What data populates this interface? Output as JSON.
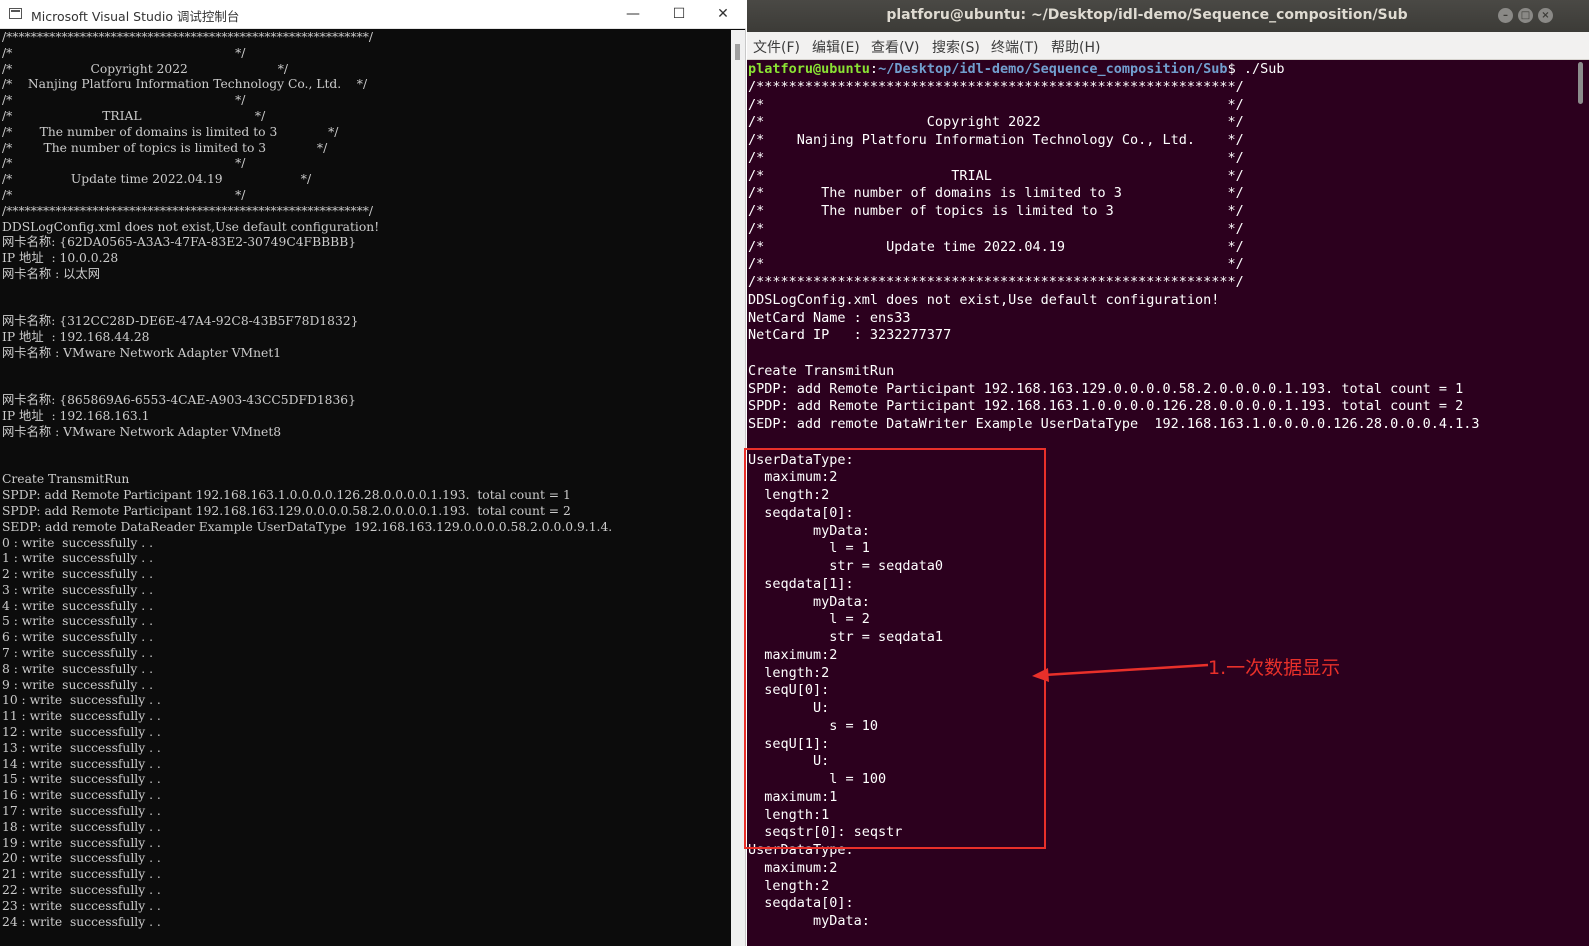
{
  "left_window": {
    "title": "Microsoft Visual Studio 调试控制台",
    "controls": {
      "minimize": "—",
      "maximize": "☐",
      "close": "✕"
    },
    "lines": [
      "/***********************************************************/",
      "/*                                                         */",
      "/*                    Copyright 2022                       */",
      "/*    Nanjing Platforu Information Technology Co., Ltd.    */",
      "/*                                                         */",
      "/*                       TRIAL                             */",
      "/*       The number of domains is limited to 3             */",
      "/*        The number of topics is limited to 3             */",
      "/*                                                         */",
      "/*               Update time 2022.04.19                    */",
      "/*                                                         */",
      "/***********************************************************/",
      "DDSLogConfig.xml does not exist,Use default configuration!",
      "网卡名称: {62DA0565-A3A3-47FA-83E2-30749C4FBBBB}",
      "IP 地址  : 10.0.0.28",
      "网卡名称 : 以太网",
      "",
      "",
      "网卡名称: {312CC28D-DE6E-47A4-92C8-43B5F78D1832}",
      "IP 地址  : 192.168.44.28",
      "网卡名称 : VMware Network Adapter VMnet1",
      "",
      "",
      "网卡名称: {865869A6-6553-4CAE-A903-43CC5DFD1836}",
      "IP 地址  : 192.168.163.1",
      "网卡名称 : VMware Network Adapter VMnet8",
      "",
      "",
      "Create TransmitRun",
      "SPDP: add Remote Participant 192.168.163.1.0.0.0.0.126.28.0.0.0.0.1.193.  total count = 1",
      "SPDP: add Remote Participant 192.168.163.129.0.0.0.0.58.2.0.0.0.0.1.193.  total count = 2",
      "SEDP: add remote DataReader Example UserDataType  192.168.163.129.0.0.0.0.58.2.0.0.0.9.1.4.",
      "0 : write  successfully . .",
      "1 : write  successfully . .",
      "2 : write  successfully . .",
      "3 : write  successfully . .",
      "4 : write  successfully . .",
      "5 : write  successfully . .",
      "6 : write  successfully . .",
      "7 : write  successfully . .",
      "8 : write  successfully . .",
      "9 : write  successfully . .",
      "10 : write  successfully . .",
      "11 : write  successfully . .",
      "12 : write  successfully . .",
      "13 : write  successfully . .",
      "14 : write  successfully . .",
      "15 : write  successfully . .",
      "16 : write  successfully . .",
      "17 : write  successfully . .",
      "18 : write  successfully . .",
      "19 : write  successfully . .",
      "20 : write  successfully . .",
      "21 : write  successfully . .",
      "22 : write  successfully . .",
      "23 : write  successfully . .",
      "24 : write  successfully . ."
    ]
  },
  "right_window": {
    "title": "platforu@ubuntu: ~/Desktop/idl-demo/Sequence_composition/Sub",
    "controls": {
      "minimize": "–",
      "maximize": "□",
      "close": "×"
    },
    "menu": [
      "文件(F)",
      "编辑(E)",
      "查看(V)",
      "搜索(S)",
      "终端(T)",
      "帮助(H)"
    ],
    "prompt": {
      "user_host": "platforu@ubuntu",
      "separator": ":",
      "path": "~/Desktop/idl-demo/Sequence_composition/Sub",
      "symbol": "$ ",
      "command": "./Sub"
    },
    "lines": [
      "/***********************************************************/",
      "/*                                                         */",
      "/*                    Copyright 2022                       */",
      "/*    Nanjing Platforu Information Technology Co., Ltd.    */",
      "/*                                                         */",
      "/*                       TRIAL                             */",
      "/*       The number of domains is limited to 3             */",
      "/*       The number of topics is limited to 3              */",
      "/*                                                         */",
      "/*               Update time 2022.04.19                    */",
      "/*                                                         */",
      "/***********************************************************/",
      "DDSLogConfig.xml does not exist,Use default configuration!",
      "NetCard Name : ens33",
      "NetCard IP   : 3232277377",
      "",
      "Create TransmitRun",
      "SPDP: add Remote Participant 192.168.163.129.0.0.0.0.58.2.0.0.0.0.1.193. total count = 1",
      "SPDP: add Remote Participant 192.168.163.1.0.0.0.0.126.28.0.0.0.0.1.193. total count = 2",
      "SEDP: add remote DataWriter Example UserDataType  192.168.163.1.0.0.0.0.126.28.0.0.0.4.1.3",
      "",
      "UserDataType:",
      "  maximum:2",
      "  length:2",
      "  seqdata[0]:",
      "        myData:",
      "          l = 1",
      "          str = seqdata0",
      "  seqdata[1]:",
      "        myData:",
      "          l = 2",
      "          str = seqdata1",
      "  maximum:2",
      "  length:2",
      "  seqU[0]:",
      "        U:",
      "          s = 10",
      "  seqU[1]:",
      "        U:",
      "          l = 100",
      "  maximum:1",
      "  length:1",
      "  seqstr[0]: seqstr",
      "UserDataType:",
      "  maximum:2",
      "  length:2",
      "  seqdata[0]:",
      "        myData:"
    ]
  },
  "annotation": {
    "label": "1.一次数据显示",
    "color": "#e8302a"
  }
}
